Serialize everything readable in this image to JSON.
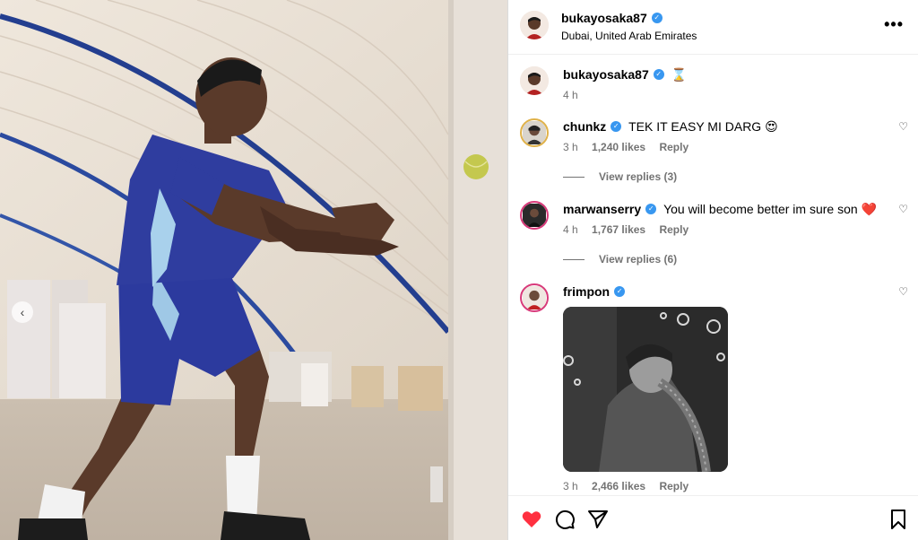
{
  "post": {
    "username": "bukayosaka87",
    "location": "Dubai, United Arab Emirates"
  },
  "caption": {
    "username": "bukayosaka87",
    "text": "⌛",
    "time": "4 h"
  },
  "comments": [
    {
      "username": "chunkz",
      "text": "TEK IT EASY MI DARG 😍",
      "time": "3 h",
      "likes": "1,240 likes",
      "reply": "Reply",
      "view_replies": "View replies (3)"
    },
    {
      "username": "marwanserry",
      "text": "You will become better im sure son ❤️",
      "time": "4 h",
      "likes": "1,767 likes",
      "reply": "Reply",
      "view_replies": "View replies (6)"
    },
    {
      "username": "frimpon",
      "text": "",
      "time": "3 h",
      "likes": "2,466 likes",
      "reply": "Reply"
    }
  ],
  "icons": {
    "verified": "verified-badge-icon",
    "more": "more-options-icon",
    "like": "heart-icon",
    "comment": "comment-icon",
    "share": "share-icon",
    "save": "bookmark-icon",
    "prev": "chevron-left-icon"
  },
  "colors": {
    "verified": "#3897f0",
    "like_active": "#ff3040",
    "muted": "#737373"
  }
}
